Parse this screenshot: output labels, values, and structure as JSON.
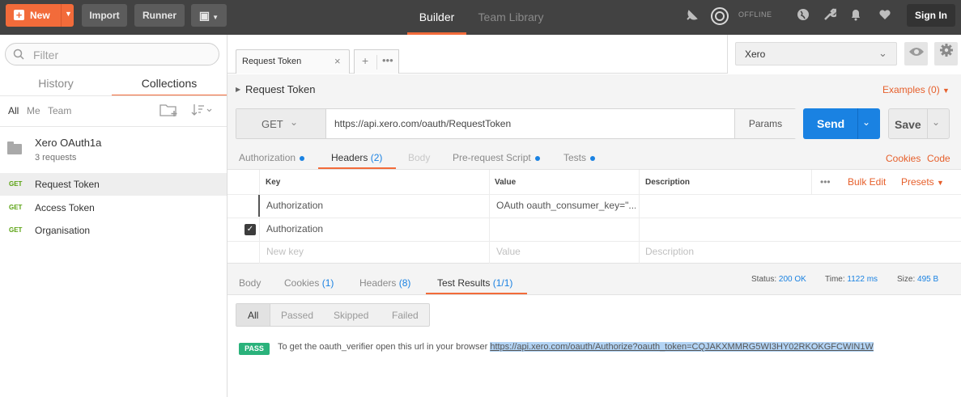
{
  "topbar": {
    "new_label": "New",
    "import_label": "Import",
    "runner_label": "Runner",
    "tabs": [
      {
        "label": "Builder",
        "active": true
      },
      {
        "label": "Team Library",
        "active": false
      }
    ],
    "offline_label": "OFFLINE",
    "signin_label": "Sign In",
    "accent": "#f26b3a"
  },
  "sidebar": {
    "filter_placeholder": "Filter",
    "tabs": [
      {
        "label": "History"
      },
      {
        "label": "Collections"
      }
    ],
    "scopes": [
      "All",
      "Me",
      "Team"
    ],
    "collection": {
      "name": "Xero OAuth1a",
      "count": "3 requests"
    },
    "requests": [
      {
        "method": "GET",
        "name": "Request Token"
      },
      {
        "method": "GET",
        "name": "Access Token"
      },
      {
        "method": "GET",
        "name": "Organisation"
      }
    ]
  },
  "request_tab": {
    "title": "Request Token"
  },
  "environment": {
    "selected": "Xero"
  },
  "request": {
    "title": "Request Token",
    "examples": "Examples (0)",
    "method": "GET",
    "url": "https://api.xero.com/oauth/RequestToken",
    "params_label": "Params",
    "send_label": "Send",
    "save_label": "Save",
    "tabs": [
      "Authorization",
      "Headers",
      "Body",
      "Pre-request Script",
      "Tests"
    ],
    "headers_count": "(2)",
    "cookies_label": "Cookies",
    "code_label": "Code"
  },
  "headers_table": {
    "columns": [
      "Key",
      "Value",
      "Description"
    ],
    "bulk_edit": "Bulk Edit",
    "presets": "Presets",
    "rows": [
      {
        "key": "Authorization",
        "value": "OAuth oauth_consumer_key=\"...",
        "description": ""
      },
      {
        "key": "Authorization",
        "value": "",
        "description": ""
      }
    ],
    "new_row": {
      "key": "New key",
      "value": "Value",
      "description": "Description"
    }
  },
  "response": {
    "tabs": [
      {
        "label": "Body",
        "count": ""
      },
      {
        "label": "Cookies",
        "count": "(1)"
      },
      {
        "label": "Headers",
        "count": "(8)"
      },
      {
        "label": "Test Results",
        "count": "(1/1)"
      }
    ],
    "status_label": "Status:",
    "status_value": "200 OK",
    "time_label": "Time:",
    "time_value": "1122 ms",
    "size_label": "Size:",
    "size_value": "495 B",
    "filters": [
      "All",
      "Passed",
      "Skipped",
      "Failed"
    ],
    "result": {
      "badge": "PASS",
      "message": "To get the oauth_verifier open this url in your browser",
      "link": "https://api.xero.com/oauth/Authorize?oauth_token=CQJAKXMMRG5WI3HY02RKOKGFCWIN1W"
    }
  }
}
